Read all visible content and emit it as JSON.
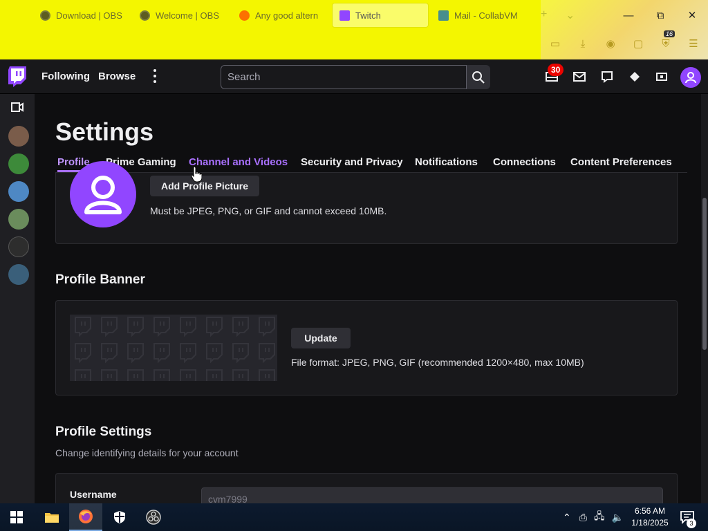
{
  "browser": {
    "tabs": [
      {
        "label": "Download | OBS",
        "icon": "obs-icon"
      },
      {
        "label": "Welcome | OBS",
        "icon": "obs-icon"
      },
      {
        "label": "Any good altern",
        "icon": "reddit-icon"
      },
      {
        "label": "Twitch",
        "icon": "twitch-icon",
        "active": true
      },
      {
        "label": "Mail - CollabVM",
        "icon": "outlook-icon"
      }
    ],
    "new_tab_symbol": "+",
    "tab_list_symbol": "⌄",
    "window_controls": {
      "minimize": "—",
      "maximize": "⧉",
      "close": "✕"
    },
    "extension_badge": "16",
    "accent_color": "#f4f600"
  },
  "twitch_nav": {
    "following": "Following",
    "browse": "Browse",
    "search_placeholder": "Search",
    "notifications_count": "30",
    "brand_color": "#9146ff"
  },
  "settings": {
    "title": "Settings",
    "tabs": [
      "Profile",
      "Prime Gaming",
      "Channel and Videos",
      "Security and Privacy",
      "Notifications",
      "Connections",
      "Content Preferences"
    ],
    "active_tab": "Profile",
    "profile_picture": {
      "button": "Add Profile Picture",
      "hint": "Must be JPEG, PNG, or GIF and cannot exceed 10MB."
    },
    "profile_banner": {
      "title": "Profile Banner",
      "button": "Update",
      "hint": "File format: JPEG, PNG, GIF (recommended 1200×480, max 10MB)"
    },
    "profile_settings": {
      "title": "Profile Settings",
      "subtitle": "Change identifying details for your account",
      "username_label": "Username",
      "username_value": "cvm7999"
    }
  },
  "taskbar": {
    "time": "6:56 AM",
    "date": "1/18/2025",
    "notifications": "3"
  }
}
